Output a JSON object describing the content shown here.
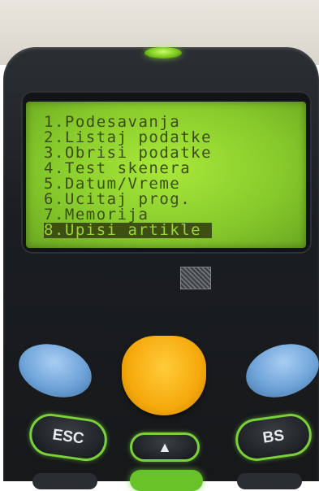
{
  "screen": {
    "menu_items": [
      "1.Podesavanja",
      "2.Listaj podatke",
      "3.Obrisi podatke",
      "4.Test skenera",
      "5.Datum/Vreme",
      "6.Ucitaj prog.",
      "7.Memorija",
      "8.Upisi artikle"
    ],
    "selected_index": 7
  },
  "keypad": {
    "esc_label": "ESC",
    "bs_label": "BS",
    "up_label": "▲"
  },
  "colors": {
    "lcd_background": "#86c92b",
    "lcd_text": "#3b4d12",
    "device_body": "#1b1e21",
    "accent_green": "#7ad13a",
    "center_key": "#f5a90c",
    "side_keys": "#6ea3d8"
  },
  "icons": {
    "brand_logo": "brand-logo-icon"
  }
}
